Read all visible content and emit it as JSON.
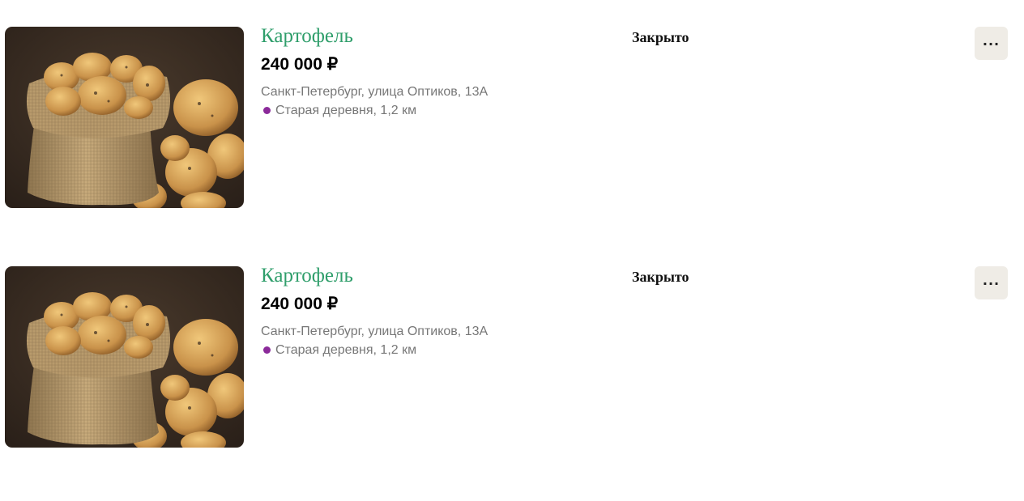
{
  "listings": [
    {
      "title": "Картофель",
      "price": "240 000 ₽",
      "address": "Санкт-Петербург, улица Оптиков, 13А",
      "metro": "Старая деревня, 1,2 км",
      "metro_line_color": "#8b2a9a",
      "status": "Закрыто",
      "more_label": "...",
      "more_icon": "more-dots-icon",
      "image": "potatoes-in-burlap-sack"
    },
    {
      "title": "Картофель",
      "price": "240 000 ₽",
      "address": "Санкт-Петербург, улица Оптиков, 13А",
      "metro": "Старая деревня, 1,2 км",
      "metro_line_color": "#8b2a9a",
      "status": "Закрыто",
      "more_label": "...",
      "more_icon": "more-dots-icon",
      "image": "potatoes-in-burlap-sack"
    }
  ],
  "colors": {
    "title": "#2f9e6b",
    "secondary_text": "#777777",
    "more_button_bg": "#efece6"
  }
}
